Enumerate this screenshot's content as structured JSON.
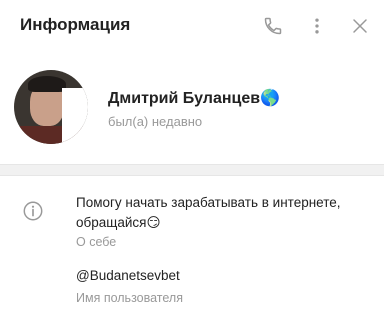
{
  "header": {
    "title": "Информация",
    "icons": {
      "call": "phone-icon",
      "more": "more-vertical-icon",
      "close": "close-icon"
    }
  },
  "profile": {
    "name": "Дмитрий Буланцев🌎",
    "status": "был(а) недавно"
  },
  "info": {
    "bio": "Помогу начать зарабатывать в интернете, обращайся😏",
    "bio_caption": "О себе",
    "username": "@Budanetsevbet",
    "username_caption": "Имя пользователя"
  },
  "colors": {
    "primary_text": "#222222",
    "secondary_text": "#999999",
    "icon": "#999999",
    "separator": "#f1f1f1"
  }
}
